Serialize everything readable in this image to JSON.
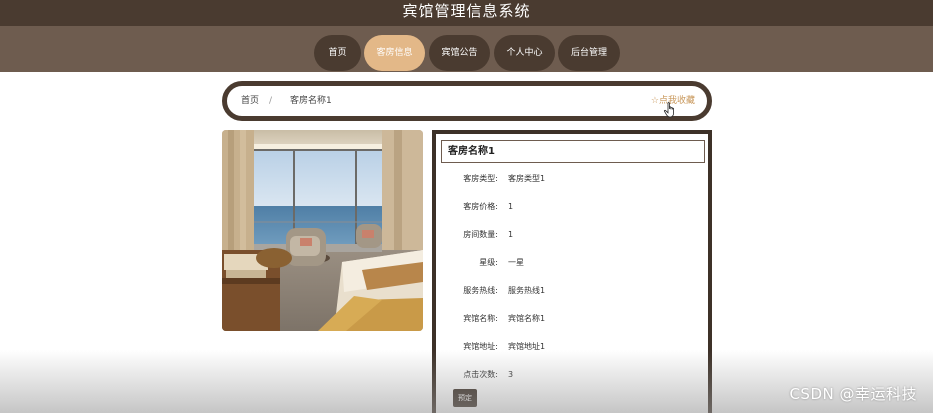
{
  "header": {
    "title": "宾馆管理信息系统"
  },
  "nav": {
    "items": [
      {
        "label": "首页"
      },
      {
        "label": "客房信息"
      },
      {
        "label": "宾馆公告"
      },
      {
        "label": "个人中心"
      },
      {
        "label": "后台管理"
      }
    ],
    "active_index": 1
  },
  "breadcrumb": {
    "home": "首页",
    "separator": "/",
    "current": "客房名称1",
    "favorite": "☆点我收藏"
  },
  "detail": {
    "title": "客房名称1",
    "fields": [
      {
        "label": "客房类型:",
        "value": "客房类型1"
      },
      {
        "label": "客房价格:",
        "value": "1"
      },
      {
        "label": "房间数量:",
        "value": "1"
      },
      {
        "label": "星级:",
        "value": "一星"
      },
      {
        "label": "服务热线:",
        "value": "服务热线1"
      },
      {
        "label": "宾馆名称:",
        "value": "宾馆名称1"
      },
      {
        "label": "宾馆地址:",
        "value": "宾馆地址1"
      },
      {
        "label": "点击次数:",
        "value": "3"
      }
    ],
    "book_label": "预定"
  },
  "watermark": "CSDN @幸运科技",
  "colors": {
    "header_bg": "#4a3b30",
    "nav_bg": "#6e5c4f",
    "nav_pill": "#4a3b30",
    "nav_active": "#e3b888",
    "favorite_text": "#c8975a"
  }
}
